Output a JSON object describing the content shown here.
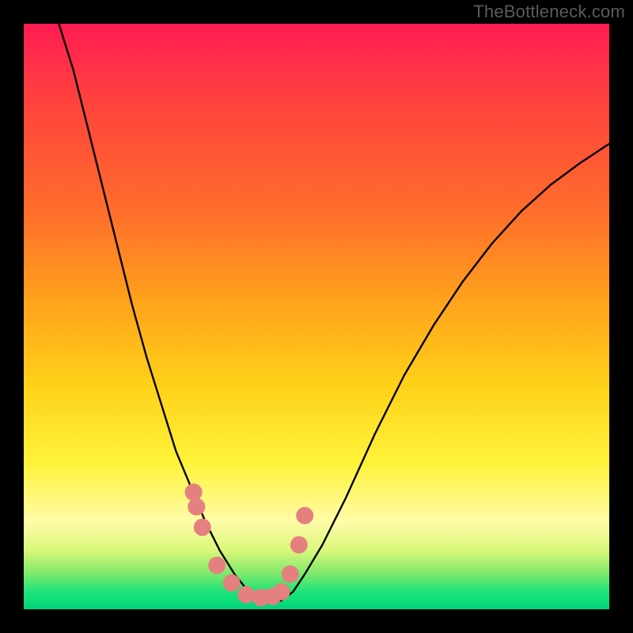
{
  "watermark": "TheBottleneck.com",
  "chart_data": {
    "type": "line",
    "title": "",
    "xlabel": "",
    "ylabel": "",
    "xlim": [
      0,
      1
    ],
    "ylim": [
      0,
      1
    ],
    "series": [
      {
        "name": "bottleneck-curve",
        "x": [
          0.06,
          0.085,
          0.11,
          0.135,
          0.16,
          0.185,
          0.21,
          0.235,
          0.26,
          0.285,
          0.31,
          0.335,
          0.36,
          0.38,
          0.4,
          0.42,
          0.44,
          0.46,
          0.48,
          0.51,
          0.55,
          0.6,
          0.65,
          0.7,
          0.75,
          0.8,
          0.85,
          0.9,
          0.95,
          1.0
        ],
        "y": [
          1.0,
          0.92,
          0.82,
          0.72,
          0.62,
          0.52,
          0.43,
          0.35,
          0.27,
          0.21,
          0.15,
          0.1,
          0.06,
          0.035,
          0.018,
          0.012,
          0.015,
          0.03,
          0.06,
          0.11,
          0.19,
          0.3,
          0.4,
          0.485,
          0.56,
          0.625,
          0.68,
          0.725,
          0.762,
          0.795
        ]
      }
    ],
    "markers": {
      "name": "highlight-dots",
      "x": [
        0.29,
        0.295,
        0.305,
        0.33,
        0.355,
        0.38,
        0.405,
        0.425,
        0.44,
        0.455,
        0.47,
        0.48
      ],
      "y": [
        0.2,
        0.175,
        0.14,
        0.075,
        0.045,
        0.025,
        0.02,
        0.022,
        0.03,
        0.06,
        0.11,
        0.16
      ]
    },
    "gradient_colors": {
      "top": "#ff1b53",
      "mid": "#fff23a",
      "bottom": "#00d47a"
    }
  }
}
